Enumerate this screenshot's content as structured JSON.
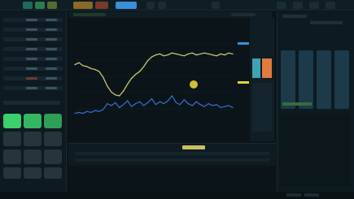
{
  "palette": {
    "background": "#0b1419",
    "accent_green": "#3ccf6e",
    "accent_orange": "#e07b3c",
    "accent_teal": "#3fa3b5",
    "line_yellow": "#d6d27a",
    "line_blue": "#3a6fd0",
    "marker_yellow": "#e8d23a"
  },
  "toolbar": {
    "tabs": [
      {
        "name": "tab-1",
        "color": "#1f6b5b"
      },
      {
        "name": "tab-2",
        "color": "#2b7d4f"
      },
      {
        "name": "tab-3",
        "color": "#556b2f"
      },
      {
        "name": "tab-4",
        "color": "#8a6a24"
      },
      {
        "name": "tab-5",
        "color": "#7a3a2a"
      },
      {
        "name": "tab-active",
        "color": "#3a8fd8"
      }
    ]
  },
  "left_panel": {
    "tiles_active": 3,
    "tiles_total": 9
  },
  "chart_data": {
    "type": "line",
    "title": "",
    "xlabel": "",
    "ylabel": "",
    "series": [
      {
        "values": [
          62,
          64,
          61,
          60,
          58,
          57,
          55,
          49,
          40,
          34,
          31,
          30,
          35,
          42,
          48,
          52,
          55,
          60,
          66,
          70,
          72,
          73,
          71,
          72,
          74,
          73,
          72,
          71,
          73,
          74,
          72,
          73,
          74,
          73,
          72,
          71,
          73,
          72,
          74,
          73
        ]
      },
      {
        "values": [
          12,
          13,
          12,
          14,
          13,
          15,
          14,
          16,
          22,
          20,
          23,
          18,
          21,
          25,
          19,
          22,
          24,
          20,
          23,
          27,
          21,
          24,
          22,
          25,
          30,
          23,
          21,
          26,
          22,
          20,
          24,
          21,
          19,
          22,
          20,
          21,
          18,
          19,
          20,
          18
        ]
      }
    ],
    "ylim": [
      0,
      100
    ],
    "grid": false
  }
}
